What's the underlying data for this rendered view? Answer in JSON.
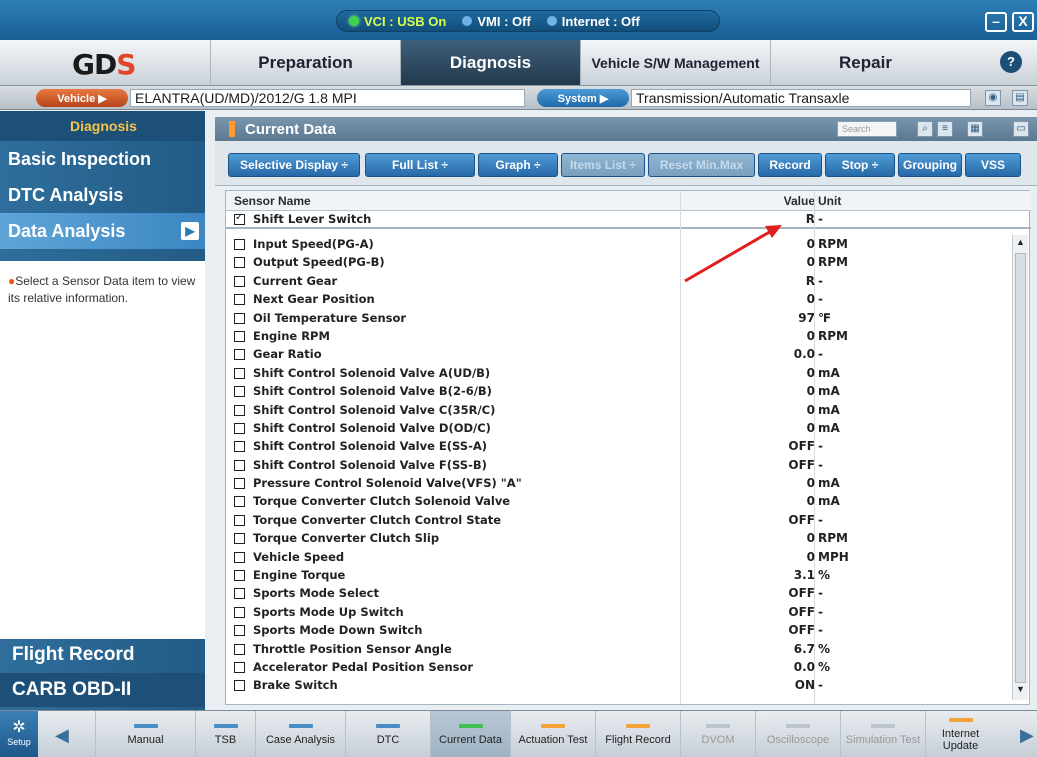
{
  "status": {
    "vci": "VCI : USB On",
    "vmi": "VMI : Off",
    "internet": "Internet : Off"
  },
  "window_buttons": {
    "minimize": "–",
    "close": "X"
  },
  "nav": {
    "logo": "GD",
    "logo_accent": "S",
    "tabs": [
      "Preparation",
      "Diagnosis",
      "Vehicle S/W Management",
      "Repair"
    ],
    "active_tab": "Diagnosis"
  },
  "vehicle_bar": {
    "vehicle_label": "Vehicle ▶",
    "vehicle_value": "ELANTRA(UD/MD)/2012/G 1.8 MPI",
    "system_label": "System ▶",
    "system_value": "Transmission/Automatic Transaxle"
  },
  "sidebar": {
    "heading": "Diagnosis",
    "items": [
      "Basic Inspection",
      "DTC Analysis",
      "Data Analysis"
    ],
    "active_item": "Data Analysis",
    "info_text": "Select a Sensor Data item to view its relative information.",
    "bottom_items": [
      "Flight Record",
      "CARB OBD-II"
    ]
  },
  "panel": {
    "title": "Current Data",
    "search_placeholder": "Search"
  },
  "toolbar": {
    "buttons": [
      "Selective Display ÷",
      "Full List ÷",
      "Graph ÷",
      "Items List ÷",
      "Reset Min.Max",
      "Record",
      "Stop ÷",
      "Grouping",
      "VSS"
    ]
  },
  "table": {
    "columns": {
      "name": "Sensor Name",
      "value": "Value",
      "unit": "Unit"
    },
    "pinned": {
      "name": "Shift Lever Switch",
      "value": "R",
      "unit": "-",
      "checked": true
    },
    "rows": [
      {
        "name": "Input Speed(PG-A)",
        "value": "0",
        "unit": "RPM"
      },
      {
        "name": "Output Speed(PG-B)",
        "value": "0",
        "unit": "RPM"
      },
      {
        "name": "Current Gear",
        "value": "R",
        "unit": "-"
      },
      {
        "name": "Next Gear Position",
        "value": "0",
        "unit": "-"
      },
      {
        "name": "Oil Temperature Sensor",
        "value": "97",
        "unit": "℉"
      },
      {
        "name": "Engine RPM",
        "value": "0",
        "unit": "RPM"
      },
      {
        "name": "Gear Ratio",
        "value": "0.0",
        "unit": "-"
      },
      {
        "name": "Shift Control Solenoid Valve A(UD/B)",
        "value": "0",
        "unit": "mA"
      },
      {
        "name": "Shift Control Solenoid Valve B(2-6/B)",
        "value": "0",
        "unit": "mA"
      },
      {
        "name": "Shift Control Solenoid Valve C(35R/C)",
        "value": "0",
        "unit": "mA"
      },
      {
        "name": "Shift Control Solenoid Valve D(OD/C)",
        "value": "0",
        "unit": "mA"
      },
      {
        "name": "Shift Control Solenoid Valve E(SS-A)",
        "value": "OFF",
        "unit": "-"
      },
      {
        "name": "Shift Control Solenoid Valve F(SS-B)",
        "value": "OFF",
        "unit": "-"
      },
      {
        "name": "Pressure Control Solenoid Valve(VFS) \"A\"",
        "value": "0",
        "unit": "mA"
      },
      {
        "name": "Torque Converter Clutch Solenoid Valve",
        "value": "0",
        "unit": "mA"
      },
      {
        "name": "Torque Converter Clutch Control State",
        "value": "OFF",
        "unit": "-"
      },
      {
        "name": "Torque Converter Clutch Slip",
        "value": "0",
        "unit": "RPM"
      },
      {
        "name": "Vehicle Speed",
        "value": "0",
        "unit": "MPH"
      },
      {
        "name": "Engine Torque",
        "value": "3.1",
        "unit": "%"
      },
      {
        "name": "Sports Mode Select",
        "value": "OFF",
        "unit": "-"
      },
      {
        "name": "Sports Mode Up Switch",
        "value": "OFF",
        "unit": "-"
      },
      {
        "name": "Sports Mode Down Switch",
        "value": "OFF",
        "unit": "-"
      },
      {
        "name": "Throttle Position Sensor Angle",
        "value": "6.7",
        "unit": "%"
      },
      {
        "name": "Accelerator Pedal Position Sensor",
        "value": "0.0",
        "unit": "%"
      },
      {
        "name": "Brake Switch",
        "value": "ON",
        "unit": "-"
      }
    ]
  },
  "bottom_bar": {
    "setup_label": "Setup",
    "buttons": [
      "Manual",
      "TSB",
      "Case Analysis",
      "DTC",
      "Current Data",
      "Actuation Test",
      "Flight Record",
      "DVOM",
      "Oscilloscope",
      "Simulation Test",
      "Internet Update"
    ],
    "active_button": "Current Data"
  },
  "colors": {
    "accent_blue": "#2769a6",
    "active_green": "#40c04f",
    "annotation_arrow": "#e02020"
  }
}
